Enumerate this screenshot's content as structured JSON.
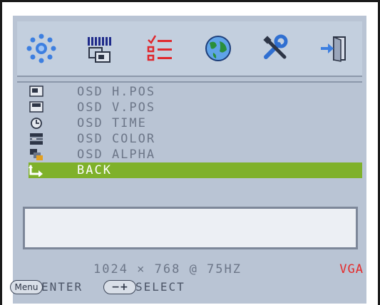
{
  "toolbar": {
    "items": [
      {
        "icon": "brightness-icon"
      },
      {
        "icon": "image-settings-icon"
      },
      {
        "icon": "osd-menu-icon",
        "active": true
      },
      {
        "icon": "color-globe-icon"
      },
      {
        "icon": "tools-icon"
      },
      {
        "icon": "exit-icon"
      }
    ]
  },
  "menu": {
    "items": [
      {
        "label": "OSD H.POS",
        "icon": "h-position-icon"
      },
      {
        "label": "OSD V.POS",
        "icon": "v-position-icon"
      },
      {
        "label": "OSD TIME",
        "icon": "timer-icon"
      },
      {
        "label": "OSD COLOR",
        "icon": "color-icon"
      },
      {
        "label": "OSD ALPHA",
        "icon": "alpha-icon"
      },
      {
        "label": "BACK",
        "icon": "back-arrow-icon",
        "selected": true
      }
    ]
  },
  "status": {
    "resolution": "1024 × 768 @ 75HZ",
    "source": "VGA",
    "menu_key": "Menu",
    "enter_label": "ENTER",
    "select_key": "−+",
    "select_label": "SELECT"
  },
  "colors": {
    "panel": "#b9c4d4",
    "selected": "#7fb12a",
    "source_text": "#e52b2b",
    "menu_text": "#6c7688"
  }
}
